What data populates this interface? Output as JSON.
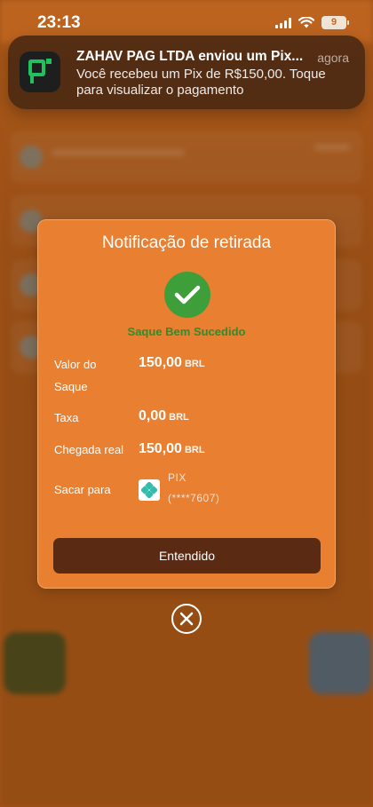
{
  "status_bar": {
    "time": "23:13",
    "battery": "9"
  },
  "notification": {
    "title": "ZAHAV PAG LTDA enviou um Pix...",
    "time": "agora",
    "body": "Você recebeu um Pix de R$150,00. Toque para visualizar o pagamento"
  },
  "modal": {
    "title": "Notificação de retirada",
    "success_text": "Saque Bem Sucedido",
    "rows": {
      "amount_label": "Valor do Saque",
      "amount_value": "150,00",
      "amount_currency": "BRL",
      "fee_label": "Taxa",
      "fee_value": "0,00",
      "fee_currency": "BRL",
      "arrival_label": "Chegada real",
      "arrival_value": "150,00",
      "arrival_currency": "BRL",
      "destination_label": "Sacar para",
      "destination_method": "PIX",
      "destination_account": "(****7607)"
    },
    "confirm_button": "Entendido"
  },
  "colors": {
    "modal_bg": "#e87f31",
    "success_green": "#3e9f3a",
    "button_bg": "#5a2a12",
    "notif_bg": "#482812"
  }
}
